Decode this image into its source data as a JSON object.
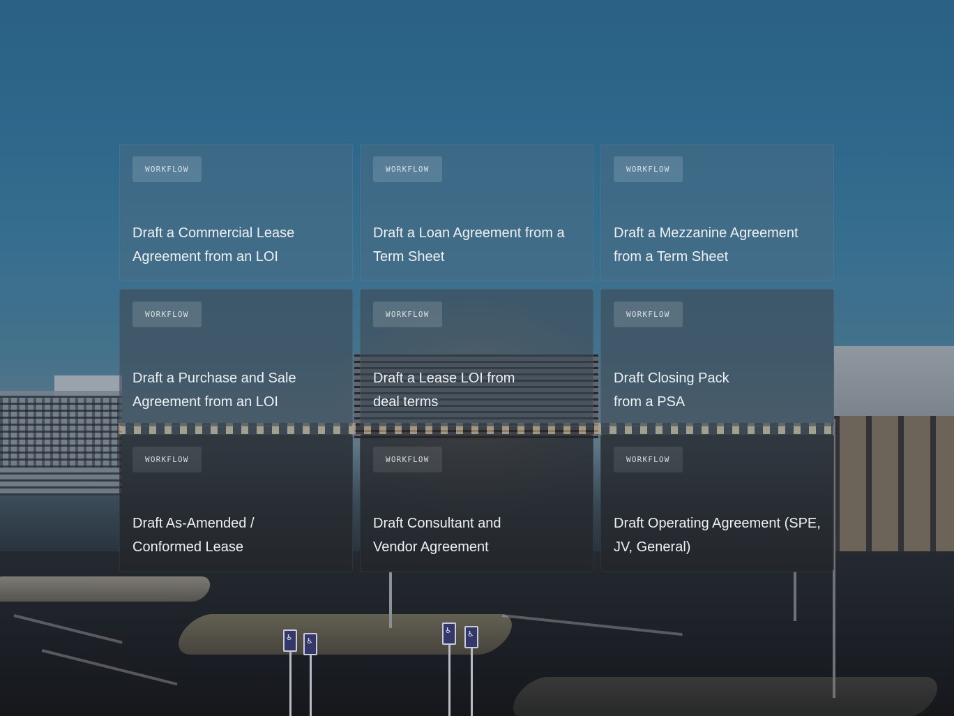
{
  "workflows": [
    {
      "badge": "WORKFLOW",
      "title": "Draft a Commercial Lease Agreement from an LOI"
    },
    {
      "badge": "WORKFLOW",
      "title": "Draft a Loan Agreement from a Term Sheet"
    },
    {
      "badge": "WORKFLOW",
      "title": "Draft a Mezzanine Agreement from a Term Sheet"
    },
    {
      "badge": "WORKFLOW",
      "title": "Draft a Purchase and Sale Agreement from an LOI"
    },
    {
      "badge": "WORKFLOW",
      "title": "Draft a Lease LOI from deal terms"
    },
    {
      "badge": "WORKFLOW",
      "title": "Draft Closing Pack from a PSA"
    },
    {
      "badge": "WORKFLOW",
      "title": "Draft As-Amended / Conformed Lease"
    },
    {
      "badge": "WORKFLOW",
      "title": "Draft Consultant and Vendor Agreement"
    },
    {
      "badge": "WORKFLOW",
      "title": "Draft Operating Agreement (SPE, JV, General)"
    }
  ]
}
